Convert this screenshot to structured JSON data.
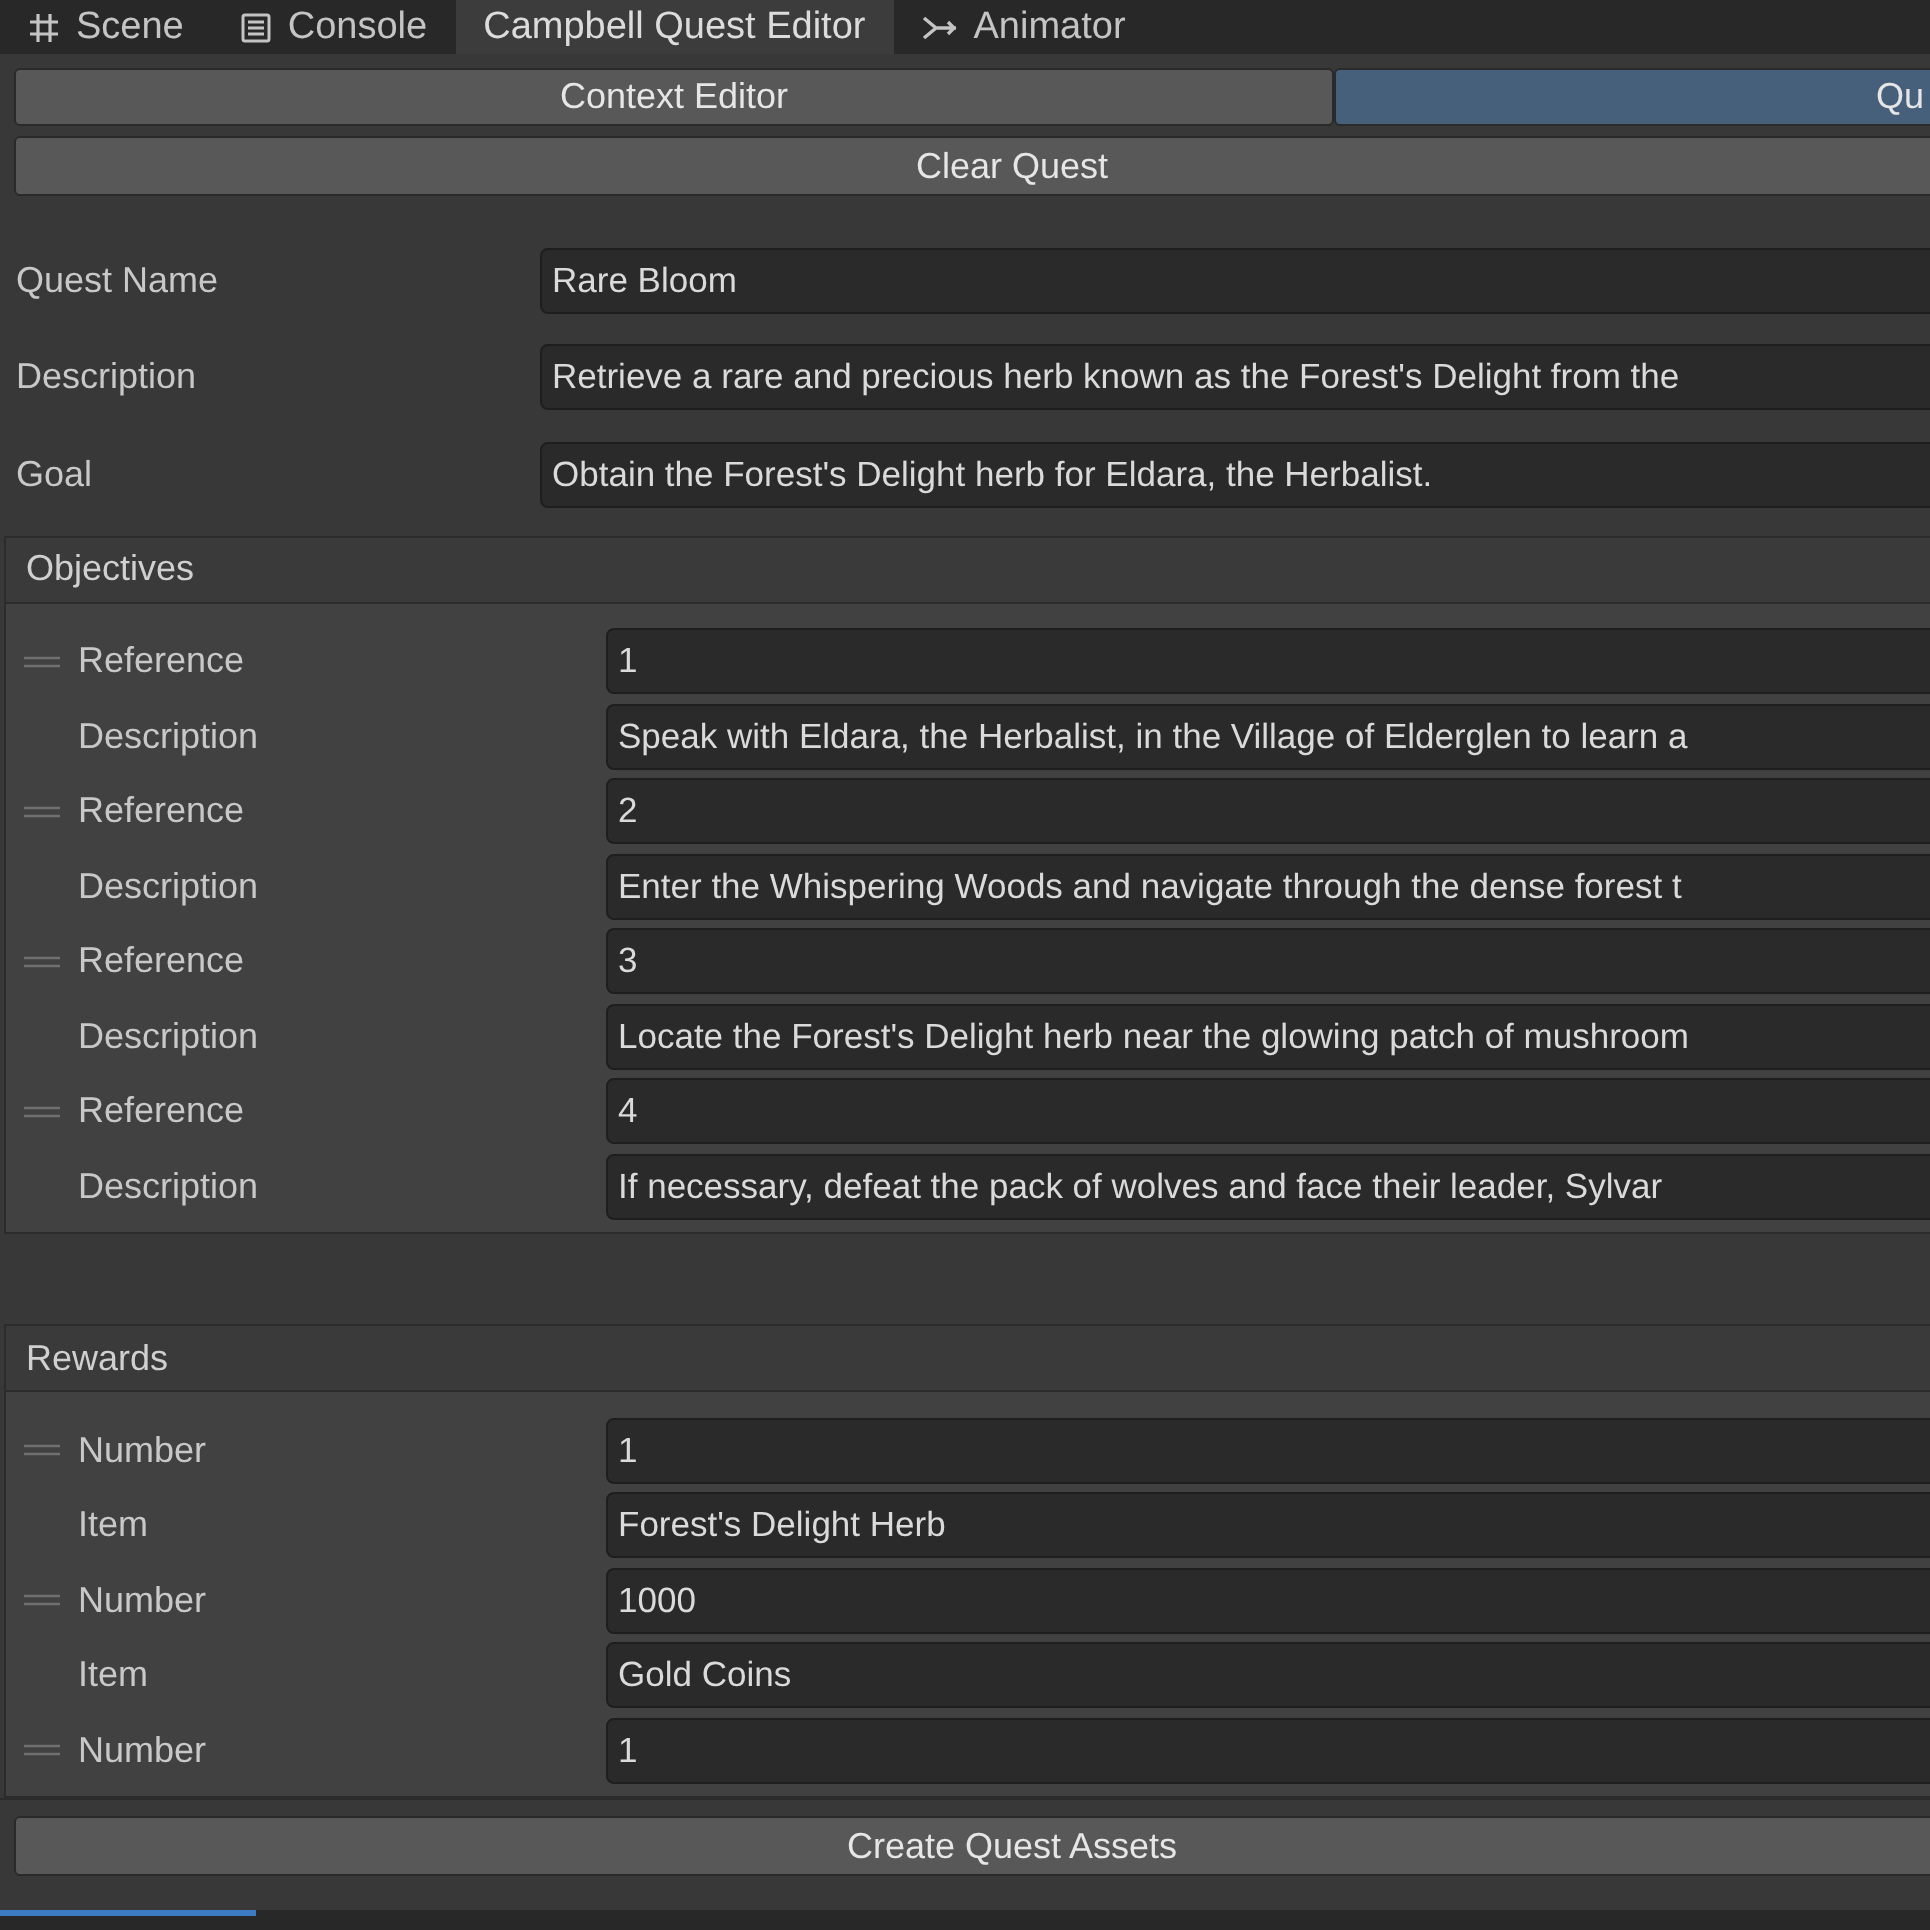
{
  "tabs": [
    {
      "label": "Scene",
      "kind": "grid",
      "selected": false
    },
    {
      "label": "Console",
      "kind": "list",
      "selected": false
    },
    {
      "label": "Campbell Quest Editor",
      "kind": "plain",
      "selected": true
    },
    {
      "label": "Animator",
      "kind": "branch",
      "selected": false
    }
  ],
  "toolbar": [
    {
      "label": "Context Editor",
      "selected": false
    },
    {
      "label": "Qu",
      "selected": true
    }
  ],
  "clear_button": "Clear Quest",
  "fields": [
    {
      "label": "Quest Name",
      "value": "Rare Bloom"
    },
    {
      "label": "Description",
      "value": "Retrieve a rare and precious herb known as the Forest's Delight from the"
    },
    {
      "label": "Goal",
      "value": "Obtain the Forest's Delight herb for Eldara, the Herbalist."
    }
  ],
  "objectives": {
    "title": "Objectives",
    "items": [
      {
        "key_label": "Reference",
        "key": "1",
        "text_label": "Description",
        "text": "Speak with Eldara, the Herbalist, in the Village of Elderglen to learn a"
      },
      {
        "key_label": "Reference",
        "key": "2",
        "text_label": "Description",
        "text": "Enter the Whispering Woods and navigate through the dense forest t"
      },
      {
        "key_label": "Reference",
        "key": "3",
        "text_label": "Description",
        "text": "Locate the Forest's Delight herb near the glowing patch of mushroom"
      },
      {
        "key_label": "Reference",
        "key": "4",
        "text_label": "Description",
        "text": "If necessary, defeat the pack of wolves and face their leader, Sylvar"
      }
    ]
  },
  "rewards": {
    "title": "Rewards",
    "items": [
      {
        "key_label": "Number",
        "key": "1",
        "text_label": "Item",
        "text": "Forest's Delight Herb"
      },
      {
        "key_label": "Number",
        "key": "1000",
        "text_label": "Item",
        "text": "Gold Coins"
      },
      {
        "key_label": "Number",
        "key": "1"
      }
    ]
  },
  "create_button": "Create Quest Assets"
}
